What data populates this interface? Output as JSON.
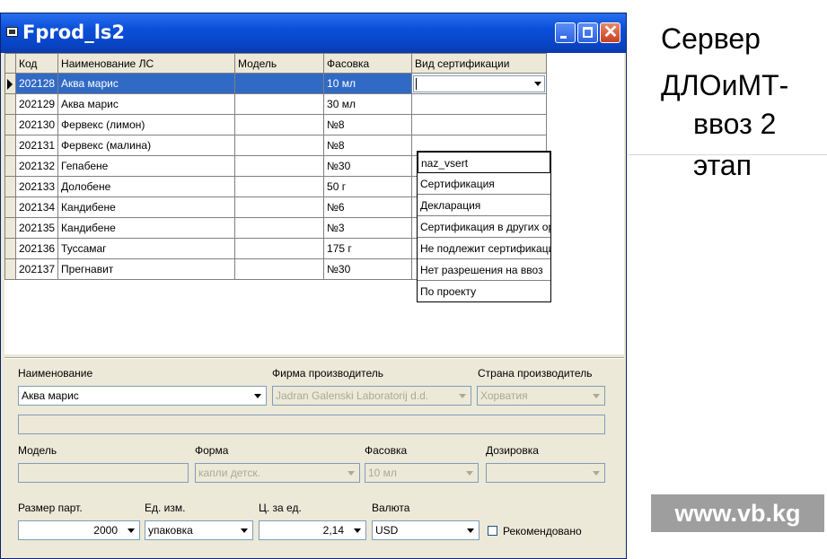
{
  "window": {
    "title": "Fprod_ls2"
  },
  "grid": {
    "columns": [
      "Код",
      "Наименование ЛС",
      "Модель",
      "Фасовка",
      "Вид сертификации"
    ],
    "rows": [
      {
        "code": "202128",
        "name": "Аква марис",
        "model": "",
        "pack": "10 мл",
        "cert": ""
      },
      {
        "code": "202129",
        "name": "Аква марис",
        "model": "",
        "pack": "30 мл",
        "cert": ""
      },
      {
        "code": "202130",
        "name": "Фервекс (лимон)",
        "model": "",
        "pack": "№8",
        "cert": ""
      },
      {
        "code": "202131",
        "name": "Фервекс (малина)",
        "model": "",
        "pack": "№8",
        "cert": ""
      },
      {
        "code": "202132",
        "name": "Гепабене",
        "model": "",
        "pack": "№30",
        "cert": ""
      },
      {
        "code": "202133",
        "name": "Долобене",
        "model": "",
        "pack": "50 г",
        "cert": ""
      },
      {
        "code": "202134",
        "name": "Кандибене",
        "model": "",
        "pack": "№6",
        "cert": ""
      },
      {
        "code": "202135",
        "name": "Кандибене",
        "model": "",
        "pack": "№3",
        "cert": ""
      },
      {
        "code": "202136",
        "name": "Туссамаг",
        "model": "",
        "pack": "175 г",
        "cert": ""
      },
      {
        "code": "202137",
        "name": "Прегнавит",
        "model": "",
        "pack": "№30",
        "cert": ""
      }
    ],
    "dropdown": [
      "naz_vsert",
      "Сертификация",
      "Декларация",
      "Сертификация в других орга",
      "Не подлежит сертификации",
      "Нет разрешения на ввоз",
      "По проекту"
    ]
  },
  "form": {
    "name_label": "Наименование",
    "name_value": "Аква марис",
    "manufacturer_label": "Фирма производитель",
    "manufacturer_value": "Jadran Galenski Laboratorij d.d.",
    "country_label": "Страна производитель",
    "country_value": "Хорватия",
    "model_label": "Модель",
    "form_label": "Форма",
    "form_value": "капли детск.",
    "pack_label": "Фасовка",
    "pack_value": "10 мл",
    "dosage_label": "Дозировка",
    "lot_label": "Размер парт.",
    "lot_value": "2000",
    "unit_label": "Ед. изм.",
    "unit_value": "упаковка",
    "price_label": "Ц. за ед.",
    "price_value": "2,14",
    "currency_label": "Валюта",
    "currency_value": "USD",
    "recommended_label": "Рекомендовано"
  },
  "side": {
    "line1": "Сервер",
    "line2": "ДЛОиМТ-",
    "line3": "ввоз 2",
    "line4": "этап",
    "watermark": "www.vb.kg"
  }
}
